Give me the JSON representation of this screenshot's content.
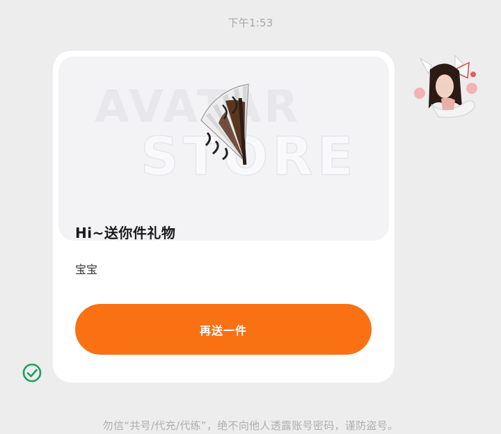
{
  "chat": {
    "timestamp": "下午1:53"
  },
  "gift_card": {
    "banner": {
      "watermark_line1": "AVATAR",
      "watermark_line2": "STORE",
      "item_icon": "folding-fan-icon"
    },
    "title": "Hi~送你件礼物",
    "message": "宝宝",
    "button_label": "再送一件",
    "accent_color": "#fa7114"
  },
  "sender": {
    "avatar_icon": "anime-girl-avatar"
  },
  "status": {
    "icon": "check-circle-icon",
    "color": "#17a05d"
  },
  "footer": {
    "notice": "勿信“共号/代充/代练”，绝不向他人透露账号密码，谨防盗号。"
  }
}
